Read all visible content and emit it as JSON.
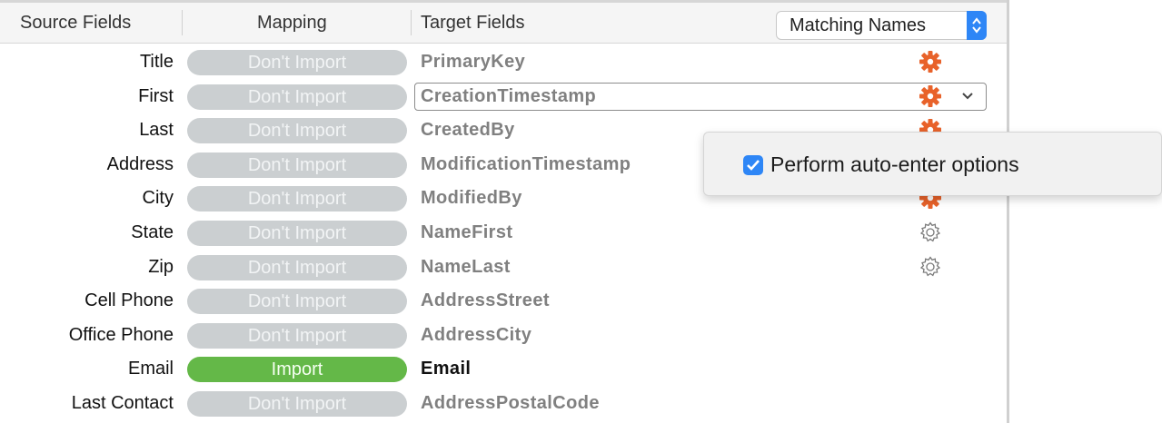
{
  "header": {
    "source_label": "Source Fields",
    "mapping_label": "Mapping",
    "target_label": "Target Fields",
    "matching_popup_value": "Matching Names"
  },
  "rows": [
    {
      "source": "Title",
      "mapping": "Don't Import",
      "target": "PrimaryKey",
      "gear": "orange"
    },
    {
      "source": "First",
      "mapping": "Don't Import",
      "target": "CreationTimestamp",
      "gear": "orange"
    },
    {
      "source": "Last",
      "mapping": "Don't Import",
      "target": "CreatedBy",
      "gear": "orange"
    },
    {
      "source": "Address",
      "mapping": "Don't Import",
      "target": "ModificationTimestamp",
      "gear": "orange"
    },
    {
      "source": "City",
      "mapping": "Don't Import",
      "target": "ModifiedBy",
      "gear": "orange"
    },
    {
      "source": "State",
      "mapping": "Don't Import",
      "target": "NameFirst",
      "gear": "gray"
    },
    {
      "source": "Zip",
      "mapping": "Don't Import",
      "target": "NameLast",
      "gear": "gray"
    },
    {
      "source": "Cell Phone",
      "mapping": "Don't Import",
      "target": "AddressStreet",
      "gear": "none"
    },
    {
      "source": "Office Phone",
      "mapping": "Don't Import",
      "target": "AddressCity",
      "gear": "none"
    },
    {
      "source": "Email",
      "mapping": "Import",
      "target": "Email",
      "gear": "none"
    },
    {
      "source": "Last Contact",
      "mapping": "Don't Import",
      "target": "AddressPostalCode",
      "gear": "none"
    }
  ],
  "popover": {
    "option_label": "Perform auto-enter options",
    "checked": true
  },
  "colors": {
    "accent": "#2e86f6",
    "import_green": "#64b848",
    "dont_import_gray": "#cbcfd1",
    "gear_orange": "#e8622a",
    "gear_gray": "#7a7a7a"
  },
  "icons": {
    "orange_gear": "gear-icon",
    "gray_gear": "gear-outline-icon",
    "chevron": "chevron-down-icon",
    "stepper": "updown-arrows-icon",
    "checkbox": "checkmark-icon"
  }
}
